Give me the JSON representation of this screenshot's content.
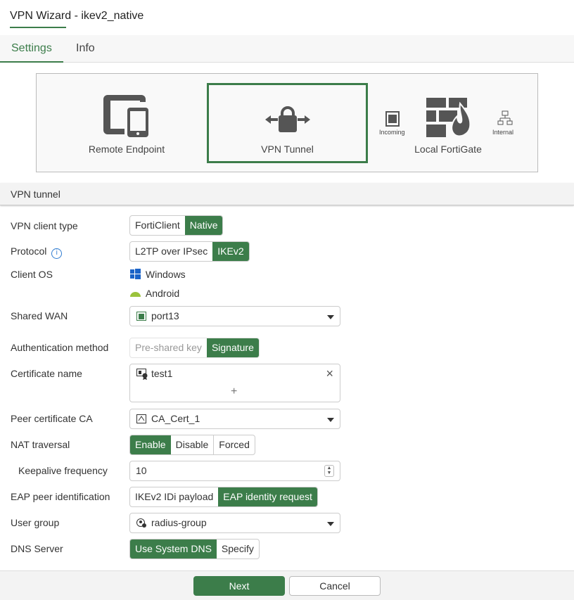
{
  "title": "VPN Wizard - ikev2_native",
  "tabs": [
    "Settings",
    "Info"
  ],
  "diagram": {
    "remote": "Remote Endpoint",
    "tunnel": "VPN Tunnel",
    "local": "Local FortiGate",
    "incoming": "Incoming",
    "internal": "Internal"
  },
  "section": "VPN tunnel",
  "fields": {
    "client_type": {
      "label": "VPN client type",
      "options": [
        "FortiClient",
        "Native"
      ],
      "selected": "Native"
    },
    "protocol": {
      "label": "Protocol",
      "options": [
        "L2TP over IPsec",
        "IKEv2"
      ],
      "selected": "IKEv2"
    },
    "client_os": {
      "label": "Client OS",
      "values": [
        "Windows",
        "Android"
      ]
    },
    "shared_wan": {
      "label": "Shared WAN",
      "value": "port13"
    },
    "auth": {
      "label": "Authentication method",
      "options": [
        "Pre-shared key",
        "Signature"
      ],
      "selected": "Signature"
    },
    "cert": {
      "label": "Certificate name",
      "value": "test1",
      "add": "+",
      "remove": "×"
    },
    "peer_ca": {
      "label": "Peer certificate CA",
      "value": "CA_Cert_1"
    },
    "nat": {
      "label": "NAT traversal",
      "options": [
        "Enable",
        "Disable",
        "Forced"
      ],
      "selected": "Enable"
    },
    "keepalive": {
      "label": "Keepalive frequency",
      "value": "10"
    },
    "eap": {
      "label": "EAP peer identification",
      "options": [
        "IKEv2 IDi payload",
        "EAP identity request"
      ],
      "selected": "EAP identity request"
    },
    "user_group": {
      "label": "User group",
      "value": "radius-group"
    },
    "dns": {
      "label": "DNS Server",
      "options": [
        "Use System DNS",
        "Specify"
      ],
      "selected": "Use System DNS"
    }
  },
  "footer": {
    "next": "Next",
    "cancel": "Cancel"
  },
  "colors": {
    "accent": "#3c7d4a"
  }
}
